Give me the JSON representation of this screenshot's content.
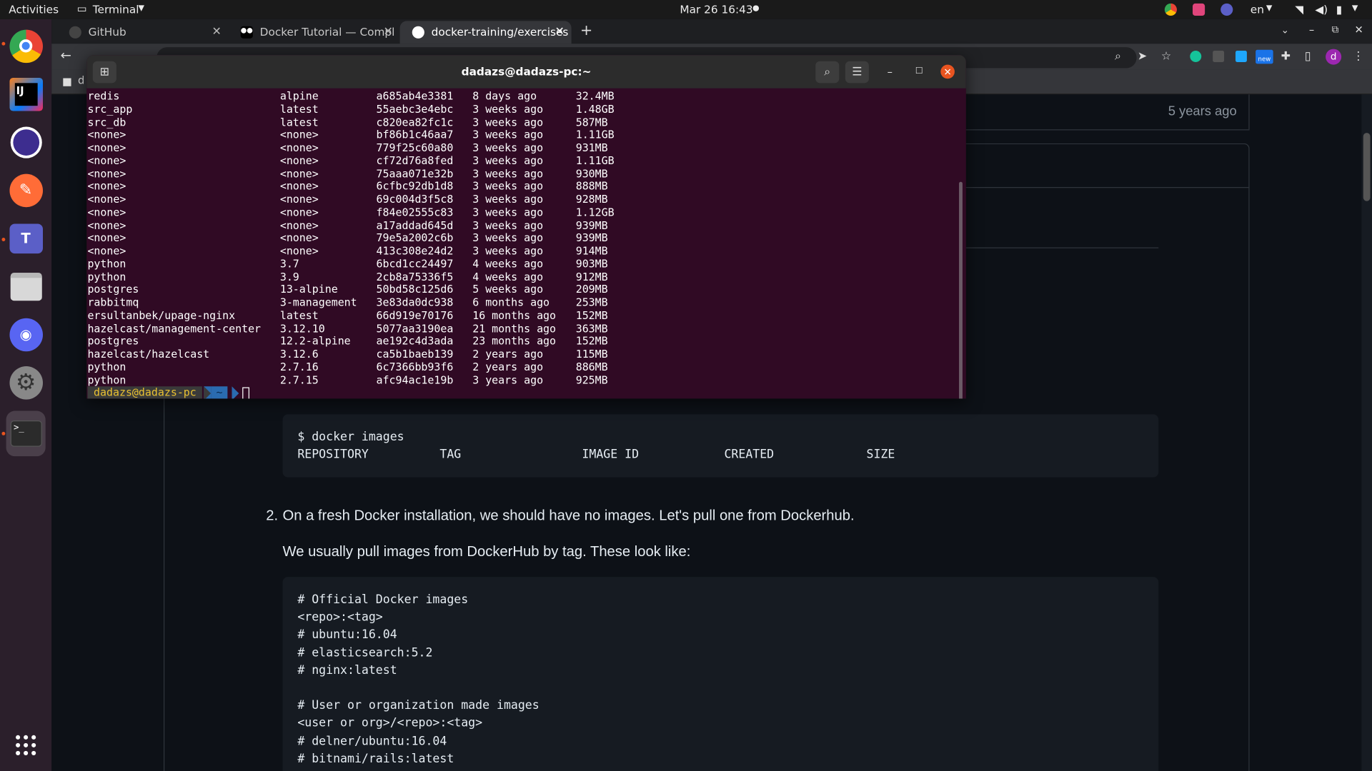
{
  "topbar": {
    "activities": "Activities",
    "app": "Terminal",
    "datetime": "Mar 26  16:43",
    "lang": "en"
  },
  "browser": {
    "tabs": [
      {
        "label": "GitHub"
      },
      {
        "label": "Docker Tutorial — Compl"
      },
      {
        "label": "docker-training/exercises"
      }
    ],
    "new_tab": "+",
    "bookmark_label": "d",
    "profile_initial": "d",
    "new_badge": "new"
  },
  "page": {
    "timestamp": "5 years ago",
    "code_block_1": "$ docker images\nREPOSITORY          TAG                 IMAGE ID            CREATED             SIZE",
    "step_number": "2.",
    "step_text": "On a fresh Docker installation, we should have no images. Let's pull one from Dockerhub.",
    "step_subtext": "We usually pull images from DockerHub by tag. These look like:",
    "code_block_2": "# Official Docker images\n<repo>:<tag>\n# ubuntu:16.04\n# elasticsearch:5.2\n# nginx:latest\n\n# User or organization made images\n<user or org>/<repo>:<tag>\n# delner/ubuntu:16.04\n# bitnami/rails:latest"
  },
  "terminal": {
    "title": "dadazs@dadazs-pc:~",
    "rows": [
      {
        "repo": "redis",
        "tag": "alpine",
        "id": "a685ab4e3381",
        "created": "8 days ago",
        "size": "32.4MB"
      },
      {
        "repo": "src_app",
        "tag": "latest",
        "id": "55aebc3e4ebc",
        "created": "3 weeks ago",
        "size": "1.48GB"
      },
      {
        "repo": "src_db",
        "tag": "latest",
        "id": "c820ea82fc1c",
        "created": "3 weeks ago",
        "size": "587MB"
      },
      {
        "repo": "<none>",
        "tag": "<none>",
        "id": "bf86b1c46aa7",
        "created": "3 weeks ago",
        "size": "1.11GB"
      },
      {
        "repo": "<none>",
        "tag": "<none>",
        "id": "779f25c60a80",
        "created": "3 weeks ago",
        "size": "931MB"
      },
      {
        "repo": "<none>",
        "tag": "<none>",
        "id": "cf72d76a8fed",
        "created": "3 weeks ago",
        "size": "1.11GB"
      },
      {
        "repo": "<none>",
        "tag": "<none>",
        "id": "75aaa071e32b",
        "created": "3 weeks ago",
        "size": "930MB"
      },
      {
        "repo": "<none>",
        "tag": "<none>",
        "id": "6cfbc92db1d8",
        "created": "3 weeks ago",
        "size": "888MB"
      },
      {
        "repo": "<none>",
        "tag": "<none>",
        "id": "69c004d3f5c8",
        "created": "3 weeks ago",
        "size": "928MB"
      },
      {
        "repo": "<none>",
        "tag": "<none>",
        "id": "f84e02555c83",
        "created": "3 weeks ago",
        "size": "1.12GB"
      },
      {
        "repo": "<none>",
        "tag": "<none>",
        "id": "a17addad645d",
        "created": "3 weeks ago",
        "size": "939MB"
      },
      {
        "repo": "<none>",
        "tag": "<none>",
        "id": "79e5a2002c6b",
        "created": "3 weeks ago",
        "size": "939MB"
      },
      {
        "repo": "<none>",
        "tag": "<none>",
        "id": "413c308e24d2",
        "created": "3 weeks ago",
        "size": "914MB"
      },
      {
        "repo": "python",
        "tag": "3.7",
        "id": "6bcd1cc24497",
        "created": "4 weeks ago",
        "size": "903MB"
      },
      {
        "repo": "python",
        "tag": "3.9",
        "id": "2cb8a75336f5",
        "created": "4 weeks ago",
        "size": "912MB"
      },
      {
        "repo": "postgres",
        "tag": "13-alpine",
        "id": "50bd58c125d6",
        "created": "5 weeks ago",
        "size": "209MB"
      },
      {
        "repo": "rabbitmq",
        "tag": "3-management",
        "id": "3e83da0dc938",
        "created": "6 months ago",
        "size": "253MB"
      },
      {
        "repo": "ersultanbek/upage-nginx",
        "tag": "latest",
        "id": "66d919e70176",
        "created": "16 months ago",
        "size": "152MB"
      },
      {
        "repo": "hazelcast/management-center",
        "tag": "3.12.10",
        "id": "5077aa3190ea",
        "created": "21 months ago",
        "size": "363MB"
      },
      {
        "repo": "postgres",
        "tag": "12.2-alpine",
        "id": "ae192c4d3ada",
        "created": "23 months ago",
        "size": "152MB"
      },
      {
        "repo": "hazelcast/hazelcast",
        "tag": "3.12.6",
        "id": "ca5b1baeb139",
        "created": "2 years ago",
        "size": "115MB"
      },
      {
        "repo": "python",
        "tag": "2.7.16",
        "id": "6c7366bb93f6",
        "created": "2 years ago",
        "size": "886MB"
      },
      {
        "repo": "python",
        "tag": "2.7.15",
        "id": "afc94ac1e19b",
        "created": "3 years ago",
        "size": "925MB"
      }
    ],
    "prompt_user": "dadazs@dadazs-pc",
    "prompt_dir": "~"
  },
  "colors": {
    "terminal_bg": "#300a24",
    "accent": "#e95420",
    "page_bg": "#0d1117"
  }
}
